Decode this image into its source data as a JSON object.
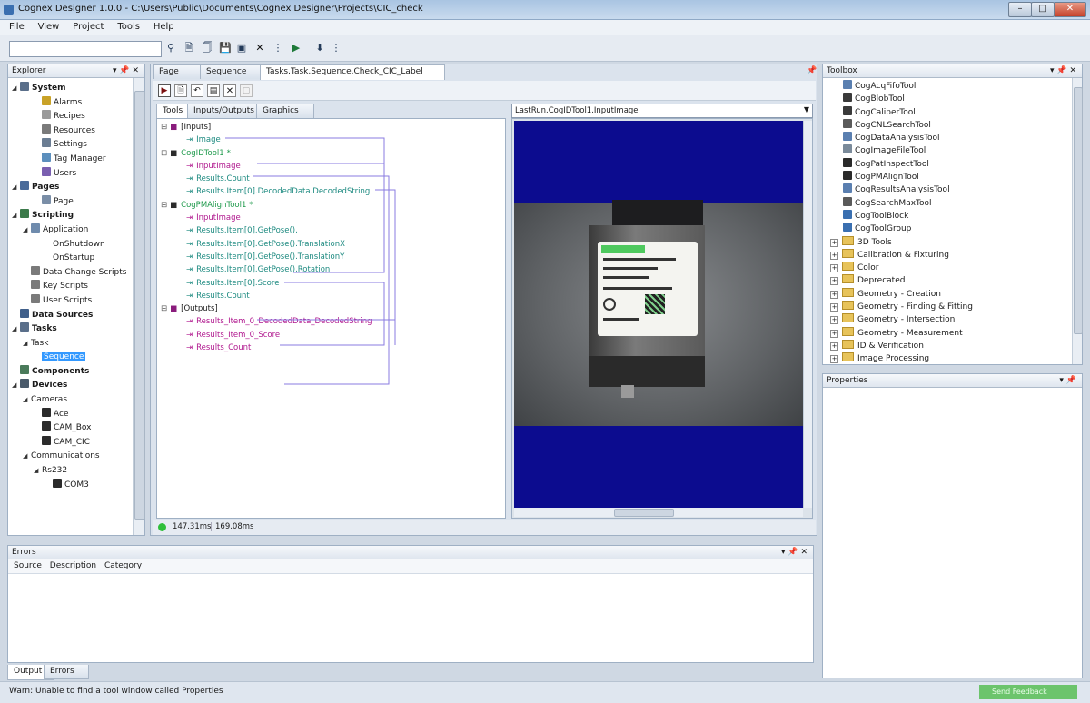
{
  "window": {
    "title": "Cognex Designer 1.0.0 - C:\\Users\\Public\\Documents\\Cognex Designer\\Projects\\CIC_check"
  },
  "menu": [
    "File",
    "View",
    "Project",
    "Tools",
    "Help"
  ],
  "explorer": {
    "title": "Explorer",
    "items": [
      {
        "label": "System",
        "bold": true,
        "indent": 0,
        "expand": "◢",
        "color": "#5a6f8a"
      },
      {
        "label": "Alarms",
        "indent": 2,
        "color": "#c9a227"
      },
      {
        "label": "Recipes",
        "indent": 2,
        "color": "#9a9a9a"
      },
      {
        "label": "Resources",
        "indent": 2,
        "color": "#7a7a7a"
      },
      {
        "label": "Settings",
        "indent": 2,
        "color": "#6b7d93"
      },
      {
        "label": "Tag Manager",
        "indent": 2,
        "color": "#5c8fbd"
      },
      {
        "label": "Users",
        "indent": 2,
        "color": "#7a5fb0"
      },
      {
        "label": "Pages",
        "bold": true,
        "indent": 0,
        "expand": "◢",
        "color": "#4a6b9a"
      },
      {
        "label": "Page",
        "indent": 2,
        "color": "#7a8ea7"
      },
      {
        "label": "Scripting",
        "bold": true,
        "indent": 0,
        "expand": "◢",
        "color": "#3b7a4a"
      },
      {
        "label": "Application",
        "indent": 1,
        "expand": "◢",
        "color": "#6f8bad"
      },
      {
        "label": "OnShutdown",
        "indent": 3,
        "color": ""
      },
      {
        "label": "OnStartup",
        "indent": 3,
        "color": ""
      },
      {
        "label": "Data Change Scripts",
        "indent": 1,
        "color": "#7a7a7a"
      },
      {
        "label": "Key Scripts",
        "indent": 1,
        "color": "#7a7a7a"
      },
      {
        "label": "User Scripts",
        "indent": 1,
        "color": "#7a7a7a"
      },
      {
        "label": "Data Sources",
        "bold": true,
        "indent": 0,
        "color": "#3f5f8a"
      },
      {
        "label": "Tasks",
        "bold": true,
        "indent": 0,
        "expand": "◢",
        "color": "#5a6f8a"
      },
      {
        "label": "Task",
        "indent": 1,
        "expand": "◢",
        "color": ""
      },
      {
        "label": "Sequence",
        "indent": 2,
        "color": "",
        "selected": true
      },
      {
        "label": "Components",
        "bold": true,
        "indent": 0,
        "color": "#4a7a5a"
      },
      {
        "label": "Devices",
        "bold": true,
        "indent": 0,
        "expand": "◢",
        "color": "#4a5a6a"
      },
      {
        "label": "Cameras",
        "indent": 1,
        "expand": "◢",
        "color": ""
      },
      {
        "label": "Ace",
        "indent": 2,
        "color": "#2b2b2b"
      },
      {
        "label": "CAM_Box",
        "indent": 2,
        "color": "#2b2b2b"
      },
      {
        "label": "CAM_CIC",
        "indent": 2,
        "color": "#2b2b2b"
      },
      {
        "label": "Communications",
        "indent": 1,
        "expand": "◢",
        "color": ""
      },
      {
        "label": "Rs232",
        "indent": 2,
        "expand": "◢",
        "color": ""
      },
      {
        "label": "COM3",
        "indent": 3,
        "color": "#2b2b2b"
      }
    ]
  },
  "doc_tabs": [
    "Page",
    "Sequence",
    "Tasks.Task.Sequence.Check_CIC_Label"
  ],
  "inner_tabs": [
    "Tools",
    "Inputs/Outputs",
    "Graphics"
  ],
  "sequence": [
    {
      "text": "[Inputs]",
      "cls": "",
      "indent": 0,
      "box": "⊟",
      "icon": "#8a1c7c"
    },
    {
      "text": "Image",
      "cls": "teal",
      "indent": 2,
      "icon": "#1d8a80"
    },
    {
      "text": "CogIDTool1",
      "cls": "grn",
      "indent": 0,
      "box": "⊟",
      "icon": "#2b2b2b",
      "star": "*"
    },
    {
      "text": "InputImage",
      "cls": "pink",
      "indent": 2,
      "icon": "#b0178e"
    },
    {
      "text": "Results.Count",
      "cls": "teal",
      "indent": 2,
      "icon": "#1d8a80"
    },
    {
      "text": "Results.Item[0].DecodedData.DecodedString",
      "cls": "teal",
      "indent": 2,
      "icon": "#1d8a80"
    },
    {
      "text": "CogPMAlignTool1",
      "cls": "grn",
      "indent": 0,
      "box": "⊟",
      "icon": "#2b2b2b",
      "star": "*"
    },
    {
      "text": "InputImage",
      "cls": "pink",
      "indent": 2,
      "icon": "#b0178e"
    },
    {
      "text": "Results.Item[0].GetPose().",
      "cls": "teal",
      "indent": 2,
      "icon": "#1d8a80"
    },
    {
      "text": "Results.Item[0].GetPose().TranslationX",
      "cls": "teal",
      "indent": 2,
      "icon": "#1d8a80"
    },
    {
      "text": "Results.Item[0].GetPose().TranslationY",
      "cls": "teal",
      "indent": 2,
      "icon": "#1d8a80"
    },
    {
      "text": "Results.Item[0].GetPose().Rotation",
      "cls": "teal",
      "indent": 2,
      "icon": "#1d8a80"
    },
    {
      "text": "Results.Item[0].Score",
      "cls": "teal",
      "indent": 2,
      "icon": "#1d8a80"
    },
    {
      "text": "Results.Count",
      "cls": "teal",
      "indent": 2,
      "icon": "#1d8a80"
    },
    {
      "text": "[Outputs]",
      "cls": "",
      "indent": 0,
      "box": "⊟",
      "icon": "#8a1c7c"
    },
    {
      "text": "Results_Item_0_DecodedData_DecodedString",
      "cls": "pink",
      "indent": 2,
      "icon": "#b0178e"
    },
    {
      "text": "Results_Item_0_Score",
      "cls": "pink",
      "indent": 2,
      "icon": "#b0178e"
    },
    {
      "text": "Results_Count",
      "cls": "pink",
      "indent": 2,
      "icon": "#b0178e"
    }
  ],
  "image_selector": "LastRun.CogIDTool1.InputImage",
  "status": {
    "time1": "147.31ms",
    "time2": "169.08ms"
  },
  "toolbox": {
    "title": "Toolbox",
    "tools": [
      {
        "label": "CogAcqFifoTool",
        "color": "#5a7fb0"
      },
      {
        "label": "CogBlobTool",
        "color": "#3a3a3a"
      },
      {
        "label": "CogCaliperTool",
        "color": "#3a3a3a"
      },
      {
        "label": "CogCNLSearchTool",
        "color": "#5a5a5a"
      },
      {
        "label": "CogDataAnalysisTool",
        "color": "#5a7fb0"
      },
      {
        "label": "CogImageFileTool",
        "color": "#7a8a9a"
      },
      {
        "label": "CogPatInspectTool",
        "color": "#2a2a2a"
      },
      {
        "label": "CogPMAlignTool",
        "color": "#2a2a2a"
      },
      {
        "label": "CogResultsAnalysisTool",
        "color": "#5a7fb0"
      },
      {
        "label": "CogSearchMaxTool",
        "color": "#5a5a5a"
      },
      {
        "label": "CogToolBlock",
        "color": "#3a6fb0"
      },
      {
        "label": "CogToolGroup",
        "color": "#3a6fb0"
      }
    ],
    "folders": [
      "3D Tools",
      "Calibration & Fixturing",
      "Color",
      "Deprecated",
      "Geometry - Creation",
      "Geometry - Finding & Fitting",
      "Geometry - Intersection",
      "Geometry - Measurement",
      "ID & Verification",
      "Image Processing"
    ]
  },
  "properties": {
    "title": "Properties"
  },
  "errors": {
    "title": "Errors",
    "columns": [
      "Source",
      "Description",
      "Category"
    ]
  },
  "bottom_tabs": [
    "Output",
    "Errors"
  ],
  "statusbar": {
    "message": "Warn: Unable to find a tool window called Properties",
    "watermark": "Send Feedback"
  }
}
